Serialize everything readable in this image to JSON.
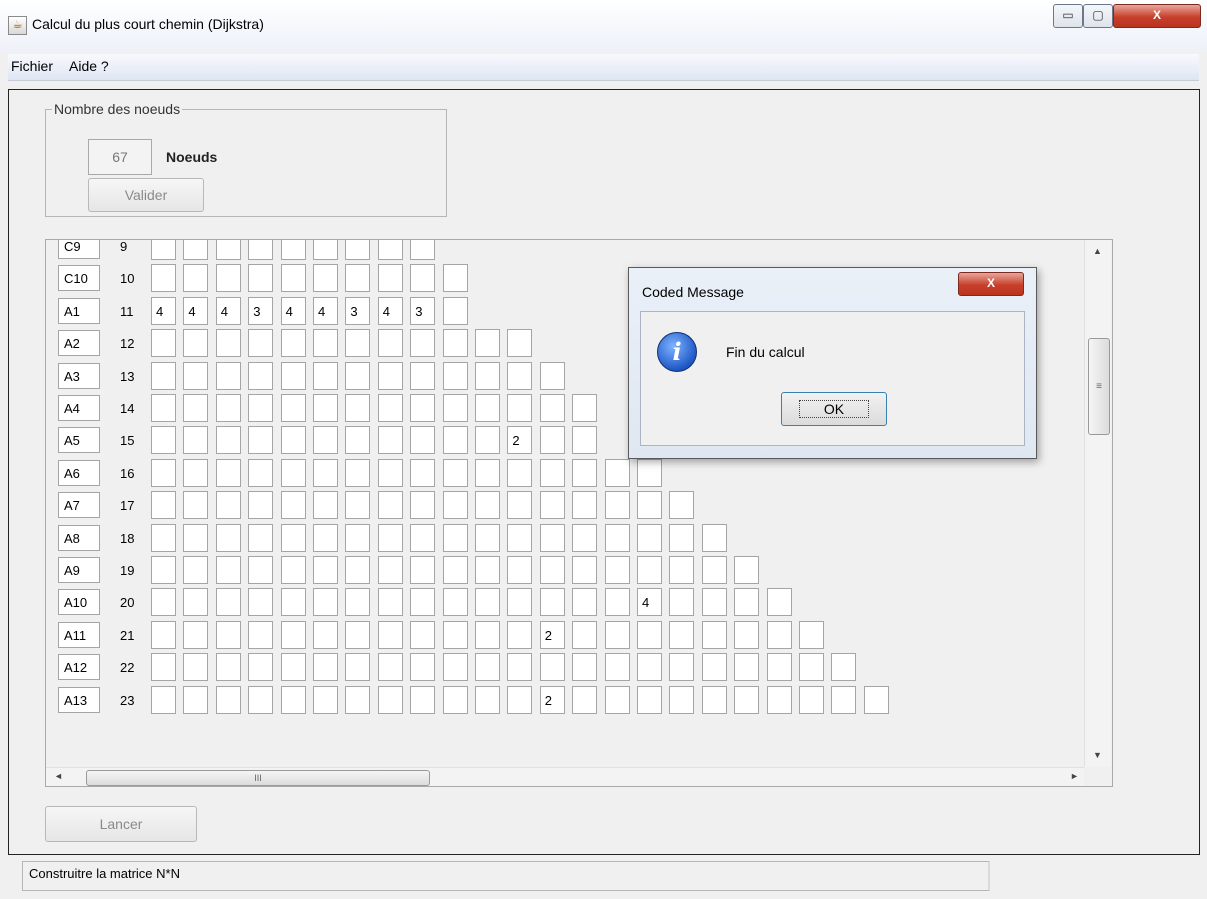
{
  "window": {
    "title": "Calcul du plus court chemin (Dijkstra)",
    "icon": "java-cup-icon"
  },
  "menu": [
    {
      "label": "Fichier"
    },
    {
      "label": "Aide ?"
    }
  ],
  "nodes_group": {
    "legend": "Nombre des noeuds",
    "value": "67",
    "unit_label": "Noeuds",
    "validate_label": "Valider"
  },
  "matrix": {
    "rows": [
      {
        "id": "C9",
        "index": "9",
        "cells": [
          "",
          "",
          "",
          "",
          "",
          "",
          "",
          "",
          ""
        ]
      },
      {
        "id": "C10",
        "index": "10",
        "cells": [
          "",
          "",
          "",
          "",
          "",
          "",
          "",
          "",
          "",
          ""
        ]
      },
      {
        "id": "A1",
        "index": "11",
        "cells": [
          "4",
          "4",
          "4",
          "3",
          "4",
          "4",
          "3",
          "4",
          "3",
          ""
        ]
      },
      {
        "id": "A2",
        "index": "12",
        "cells": [
          "",
          "",
          "",
          "",
          "",
          "",
          "",
          "",
          "",
          "",
          "",
          ""
        ]
      },
      {
        "id": "A3",
        "index": "13",
        "cells": [
          "",
          "",
          "",
          "",
          "",
          "",
          "",
          "",
          "",
          "",
          "",
          "",
          ""
        ]
      },
      {
        "id": "A4",
        "index": "14",
        "cells": [
          "",
          "",
          "",
          "",
          "",
          "",
          "",
          "",
          "",
          "",
          "",
          "",
          "",
          ""
        ]
      },
      {
        "id": "A5",
        "index": "15",
        "cells": [
          "",
          "",
          "",
          "",
          "",
          "",
          "",
          "",
          "",
          "",
          "",
          "2",
          "",
          ""
        ]
      },
      {
        "id": "A6",
        "index": "16",
        "cells": [
          "",
          "",
          "",
          "",
          "",
          "",
          "",
          "",
          "",
          "",
          "",
          "",
          "",
          "",
          "",
          ""
        ]
      },
      {
        "id": "A7",
        "index": "17",
        "cells": [
          "",
          "",
          "",
          "",
          "",
          "",
          "",
          "",
          "",
          "",
          "",
          "",
          "",
          "",
          "",
          "",
          ""
        ]
      },
      {
        "id": "A8",
        "index": "18",
        "cells": [
          "",
          "",
          "",
          "",
          "",
          "",
          "",
          "",
          "",
          "",
          "",
          "",
          "",
          "",
          "",
          "",
          "",
          ""
        ]
      },
      {
        "id": "A9",
        "index": "19",
        "cells": [
          "",
          "",
          "",
          "",
          "",
          "",
          "",
          "",
          "",
          "",
          "",
          "",
          "",
          "",
          "",
          "",
          "",
          "",
          ""
        ]
      },
      {
        "id": "A10",
        "index": "20",
        "cells": [
          "",
          "",
          "",
          "",
          "",
          "",
          "",
          "",
          "",
          "",
          "",
          "",
          "",
          "",
          "",
          "4",
          "",
          "",
          "",
          ""
        ]
      },
      {
        "id": "A11",
        "index": "21",
        "cells": [
          "",
          "",
          "",
          "",
          "",
          "",
          "",
          "",
          "",
          "",
          "",
          "",
          "2",
          "",
          "",
          "",
          "",
          "",
          "",
          "",
          ""
        ]
      },
      {
        "id": "A12",
        "index": "22",
        "cells": [
          "",
          "",
          "",
          "",
          "",
          "",
          "",
          "",
          "",
          "",
          "",
          "",
          "",
          "",
          "",
          "",
          "",
          "",
          "",
          "",
          "",
          ""
        ]
      },
      {
        "id": "A13",
        "index": "23",
        "cells": [
          "",
          "",
          "",
          "",
          "",
          "",
          "",
          "",
          "",
          "",
          "",
          "",
          "2",
          "",
          "",
          "",
          "",
          "",
          "",
          "",
          "",
          "",
          ""
        ]
      }
    ]
  },
  "launch_label": "Lancer",
  "status": "Construitre la matrice N*N",
  "dialog": {
    "title": "Coded Message",
    "message": "Fin du calcul",
    "ok_label": "OK",
    "icon": "info-icon"
  },
  "scrollbars": {
    "vertical_glyph": "≡",
    "horizontal_glyph": "III",
    "up": "▲",
    "down": "▼",
    "left": "◄",
    "right": "►"
  },
  "window_controls": {
    "minimize": "▭",
    "maximize": "▢",
    "close": "X"
  }
}
